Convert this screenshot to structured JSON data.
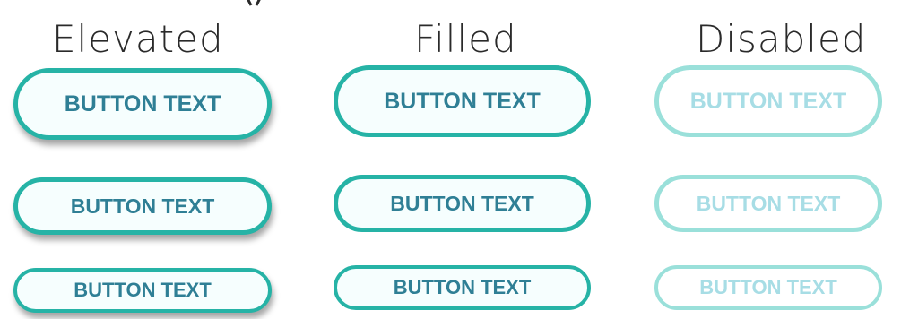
{
  "columns": {
    "elevated": "Elevated",
    "filled": "Filled",
    "disabled": "Disabled"
  },
  "buttons": {
    "elevated": {
      "large": "BUTTON TEXT",
      "medium": "BUTTON TEXT",
      "small": "BUTTON TEXT"
    },
    "filled": {
      "large": "BUTTON TEXT",
      "medium": "BUTTON TEXT",
      "small": "BUTTON TEXT"
    },
    "disabled": {
      "large": "BUTTON TEXT",
      "medium": "BUTTON TEXT",
      "small": "BUTTON TEXT"
    }
  },
  "colors": {
    "border": "#26b3a6",
    "border_disabled": "#9ae0da",
    "text": "#2f7f95",
    "text_disabled": "#a7dde5",
    "fill": "#f6fefe"
  }
}
